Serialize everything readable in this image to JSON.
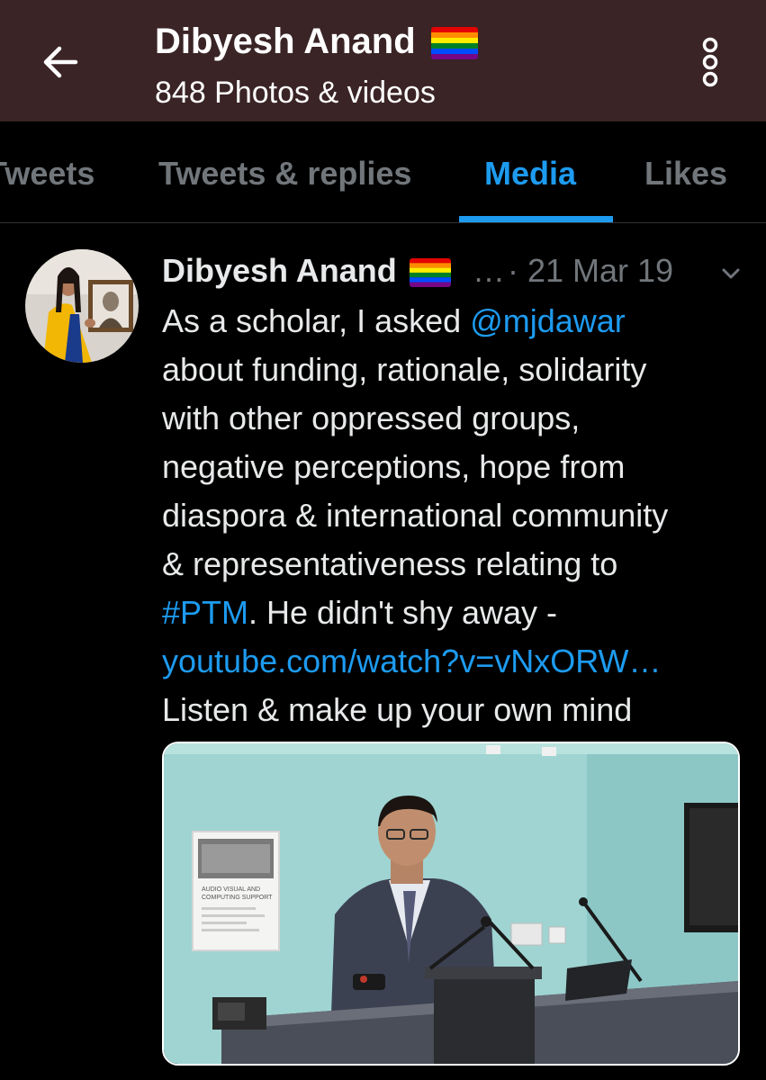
{
  "header": {
    "title": "Dibyesh Anand",
    "subtitle": "848 Photos & videos",
    "back_icon": "arrow-left-icon",
    "more_icon": "more-vertical-icon",
    "background": "#3a2425"
  },
  "tabs": [
    {
      "label": "Tweets",
      "active": false
    },
    {
      "label": "Tweets & replies",
      "active": false
    },
    {
      "label": "Media",
      "active": true
    },
    {
      "label": "Likes",
      "active": false
    }
  ],
  "tweet": {
    "author": "Dibyesh Anand",
    "ellipsis": "…",
    "date": "· 21 Mar 19",
    "text_lines": {
      "l1_pre": "As a scholar, I asked ",
      "l1_mention": "@mjdawar",
      "l2": "about funding, rationale, solidarity",
      "l3": "with other oppressed groups,",
      "l4": "negative perceptions, hope from",
      "l5": "diaspora & international community",
      "l6": "& representativeness relating to",
      "l7_hashtag": "#PTM",
      "l7_post": ". He didn't shy away -",
      "l8_link": "youtube.com/watch?v=vNxORW…",
      "l9": "Listen & make up your own mind"
    },
    "media_poster": {
      "line1": "AUDIO VISUAL AND",
      "line2": "COMPUTING SUPPORT"
    }
  },
  "colors": {
    "accent": "#1d9bf0",
    "text": "#e7e9ea",
    "muted": "#71767b",
    "background": "#000000"
  }
}
